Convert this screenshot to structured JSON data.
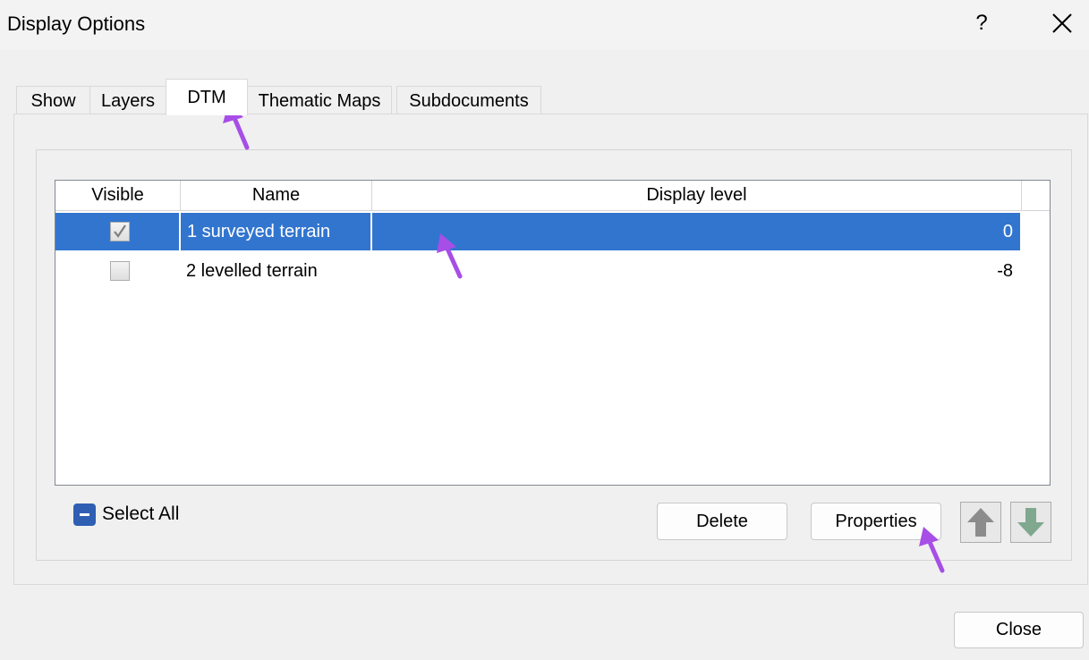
{
  "window": {
    "title": "Display Options",
    "help_label": "?"
  },
  "tabs": [
    {
      "label": "Show",
      "active": false
    },
    {
      "label": "Layers",
      "active": false
    },
    {
      "label": "DTM",
      "active": true
    },
    {
      "label": "Thematic Maps",
      "active": false
    },
    {
      "label": "Subdocuments",
      "active": false
    }
  ],
  "table": {
    "columns": [
      "Visible",
      "Name",
      "Display level"
    ],
    "rows": [
      {
        "visible": true,
        "name": "1 surveyed terrain",
        "level": "0",
        "selected": true
      },
      {
        "visible": false,
        "name": "2 levelled terrain",
        "level": "-8",
        "selected": false
      }
    ]
  },
  "controls": {
    "select_all_label": "Select All",
    "delete_label": "Delete",
    "properties_label": "Properties",
    "move_up_icon": "arrow-up-icon",
    "move_down_icon": "arrow-down-icon",
    "close_label": "Close"
  },
  "colors": {
    "selection": "#3275cf",
    "annotation_arrow": "#a64ee6",
    "up_arrow": "#8c8c8c",
    "down_arrow": "#7fa88f"
  }
}
